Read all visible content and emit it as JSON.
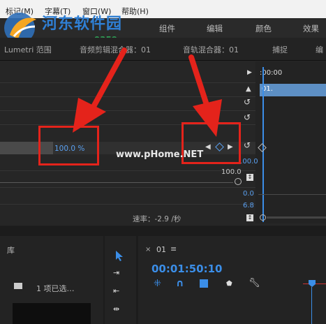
{
  "watermark": {
    "site_cn": "河东软件园",
    "url": "www.pc0359.cn",
    "body_mark": "www.pHome.NET"
  },
  "menu": {
    "items": [
      "标记(M)",
      "字幕(T)",
      "窗口(W)",
      "帮助(H)"
    ]
  },
  "workspaces": [
    "组件",
    "编辑",
    "颜色",
    "效果"
  ],
  "panel_tabs": [
    "Lumetri 范围",
    "音频剪辑混合器：01",
    "音轨混合器：01",
    "捕捉",
    "编"
  ],
  "effects": {
    "percent_value": "100.0 %",
    "slider_value": "100.0",
    "rate_label": "速率：-2.9 /秒",
    "graph_values": [
      "100.0",
      "0.0",
      "6.8"
    ]
  },
  "mini_timeline": {
    "time": ":00:00",
    "clip_name": "01."
  },
  "project": {
    "title": "库",
    "selection": "1 项已选…"
  },
  "sequence": {
    "tab_name": "01",
    "timecode": "00:01:50:10"
  },
  "colors": {
    "accent": "#3b8ee8",
    "red": "#e4231b",
    "clip": "#5d8fc4"
  }
}
